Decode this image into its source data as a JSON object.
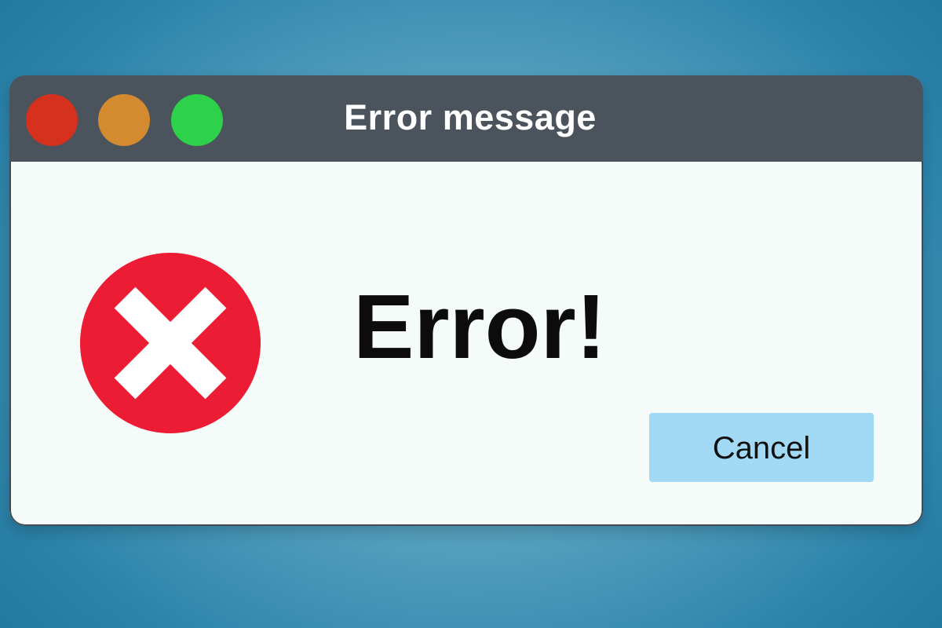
{
  "window": {
    "title": "Error message",
    "controls": [
      "close",
      "minimize",
      "maximize"
    ]
  },
  "dialog": {
    "icon": "error-x-icon",
    "heading": "Error!",
    "cancel_label": "Cancel"
  },
  "colors": {
    "titlebar": "#4b535d",
    "close": "#d6301f",
    "minimize": "#d48a2f",
    "maximize": "#2ed24a",
    "error_red": "#ec1c34",
    "button": "#a2d9f4",
    "dialog_bg": "#f5fbf8"
  }
}
